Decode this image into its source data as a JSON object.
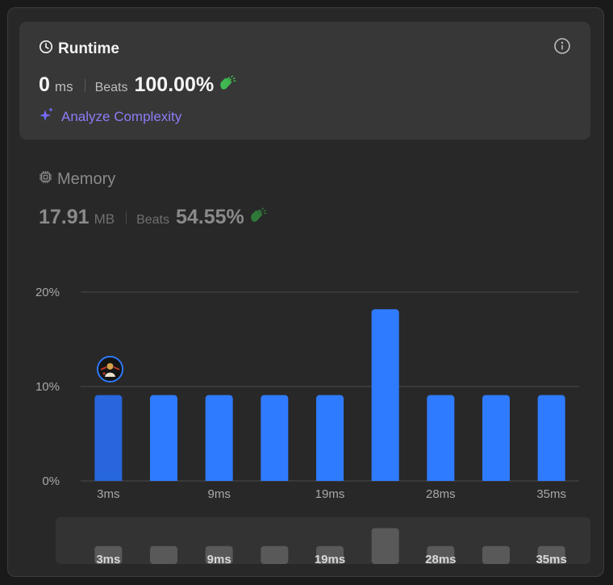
{
  "runtime": {
    "title": "Runtime",
    "value": "0",
    "unit": "ms",
    "beats_label": "Beats",
    "beats_value": "100.00%",
    "analyze_label": "Analyze Complexity",
    "icons": [
      "clock-icon",
      "info-icon",
      "clap-icon",
      "sparkle-icon"
    ]
  },
  "memory": {
    "title": "Memory",
    "value": "17.91",
    "unit": "MB",
    "beats_label": "Beats",
    "beats_value": "54.55%",
    "icons": [
      "cpu-icon",
      "clap-icon"
    ]
  },
  "chart_data": {
    "type": "bar",
    "y_ticks": [
      "20%",
      "10%",
      "0%"
    ],
    "ylim": [
      0,
      20
    ],
    "x_tick_labels": [
      "3ms",
      "9ms",
      "19ms",
      "28ms",
      "35ms"
    ],
    "values": [
      9.09,
      9.09,
      9.09,
      9.09,
      9.09,
      18.18,
      9.09,
      9.09,
      9.09
    ],
    "highlighted_index": 0,
    "grid": true,
    "colors": {
      "bar": "#2f7bff",
      "bar_active": "#2766dd",
      "grid": "#4a4a4a",
      "mini_bar": "#595959"
    }
  }
}
